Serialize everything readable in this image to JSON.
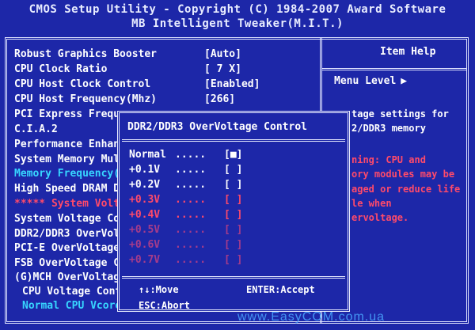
{
  "header": {
    "line1": "CMOS Setup Utility - Copyright (C) 1984-2007 Award Software",
    "line2": "MB Intelligent Tweaker(M.I.T.)"
  },
  "settings": [
    {
      "label": "Robust Graphics Booster",
      "value": "[Auto]"
    },
    {
      "label": "CPU Clock Ratio",
      "value": "[ 7 X]"
    },
    {
      "label": "CPU Host Clock Control",
      "value": "[Enabled]"
    },
    {
      "label": "CPU Host Frequency(Mhz)",
      "value": "[266]"
    },
    {
      "label": "PCI Express Frequ"
    },
    {
      "label": "C.I.A.2"
    },
    {
      "label": "Performance Enhan"
    },
    {
      "label": "System Memory Mul"
    },
    {
      "label": "Memory Frequency("
    },
    {
      "label": "High Speed DRAM D"
    },
    {
      "label": "***** System Volt"
    },
    {
      "label": "System Voltage Co"
    },
    {
      "label": "DDR2/DDR3 OverVol"
    },
    {
      "label": "PCI-E OverVoltage"
    },
    {
      "label": "FSB OverVoltage C"
    },
    {
      "label": "(G)MCH OverVoltag"
    },
    {
      "label": "CPU Voltage Contr"
    },
    {
      "label": "Normal CPU Vcore"
    }
  ],
  "help": {
    "title": "Item Help",
    "menu_level": "Menu Level",
    "menu_arrow": "▶",
    "text": [
      "tage settings for",
      "2/DDR3 memory",
      "",
      "ning: CPU and",
      "ory modules may be",
      "aged or reduce life",
      "le when",
      "ervoltage."
    ]
  },
  "popup": {
    "title": "DDR2/DDR3 OverVoltage Control",
    "options": [
      {
        "label": "Normal",
        "dots": ".....",
        "box": "[■]"
      },
      {
        "label": "+0.1V",
        "dots": ".....",
        "box": "[ ]"
      },
      {
        "label": "+0.2V",
        "dots": ".....",
        "box": "[ ]"
      },
      {
        "label": "+0.3V",
        "dots": ".....",
        "box": "[ ]"
      },
      {
        "label": "+0.4V",
        "dots": ".....",
        "box": "[ ]"
      },
      {
        "label": "+0.5V",
        "dots": ".....",
        "box": "[ ]"
      },
      {
        "label": "+0.6V",
        "dots": ".....",
        "box": "[ ]"
      },
      {
        "label": "+0.7V",
        "dots": ".....",
        "box": "[ ]"
      }
    ],
    "footer": {
      "move": "↑↓:Move",
      "accept": "ENTER:Accept",
      "abort": "ESC:Abort"
    }
  },
  "watermark": "www.EasyCOM.com.ua",
  "colors": {
    "background": "#1d27a8",
    "text": "#ffffff",
    "highlight": "#37d6ff",
    "warning": "#ff4a6a"
  }
}
